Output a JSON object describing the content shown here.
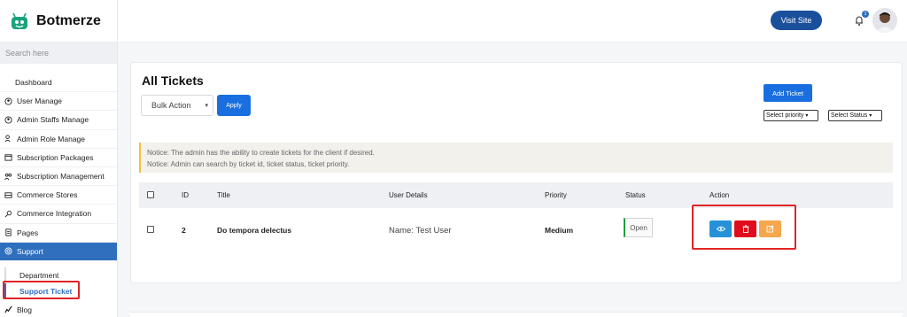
{
  "brand": {
    "name": "Botmerze",
    "accent": "#1aa37f"
  },
  "search": {
    "placeholder": "Search here"
  },
  "sidebar": {
    "items": [
      {
        "label": "Dashboard",
        "icon": "none"
      },
      {
        "label": "User Manage",
        "icon": "user-circle-icon"
      },
      {
        "label": "Admin Staffs Manage",
        "icon": "user-circle-icon"
      },
      {
        "label": "Admin Role Manage",
        "icon": "user-key-icon"
      },
      {
        "label": "Subscription Packages",
        "icon": "package-icon"
      },
      {
        "label": "Subscription Management",
        "icon": "users-icon"
      },
      {
        "label": "Commerce Stores",
        "icon": "store-icon"
      },
      {
        "label": "Commerce Integration",
        "icon": "plug-icon"
      },
      {
        "label": "Pages",
        "icon": "page-icon"
      },
      {
        "label": "Support",
        "icon": "support-icon",
        "active": true
      }
    ],
    "support_sub": [
      {
        "label": "Department"
      },
      {
        "label": "Support Ticket",
        "active": true
      }
    ],
    "after": [
      {
        "label": "Blog",
        "icon": "blog-icon"
      }
    ],
    "active_color": "#2f6fbd"
  },
  "header": {
    "visit_site_label": "Visit Site",
    "notification_count": "1"
  },
  "page": {
    "title": "All Tickets",
    "bulk_action_value": "Bulk Action",
    "apply_label": "Apply",
    "add_ticket_label": "Add Ticket",
    "priority_filter_value": "Select priority",
    "status_filter_value": "Select Status",
    "notice_lines": [
      "Notice: The admin has the ability to create tickets for the client if desired.",
      "Notice: Admin can search by ticket id, ticket status, ticket priority."
    ]
  },
  "table": {
    "columns": [
      "ID",
      "Title",
      "User Details",
      "Priority",
      "Status",
      "Action"
    ],
    "rows": [
      {
        "id": "2",
        "title": "Do tempora delectus",
        "user_details": "Name: Test User",
        "priority": "Medium",
        "status": "Open"
      }
    ]
  },
  "actions": {
    "view_color": "#2691d9",
    "delete_color": "#e00b1c",
    "edit_color": "#f4a74c"
  }
}
